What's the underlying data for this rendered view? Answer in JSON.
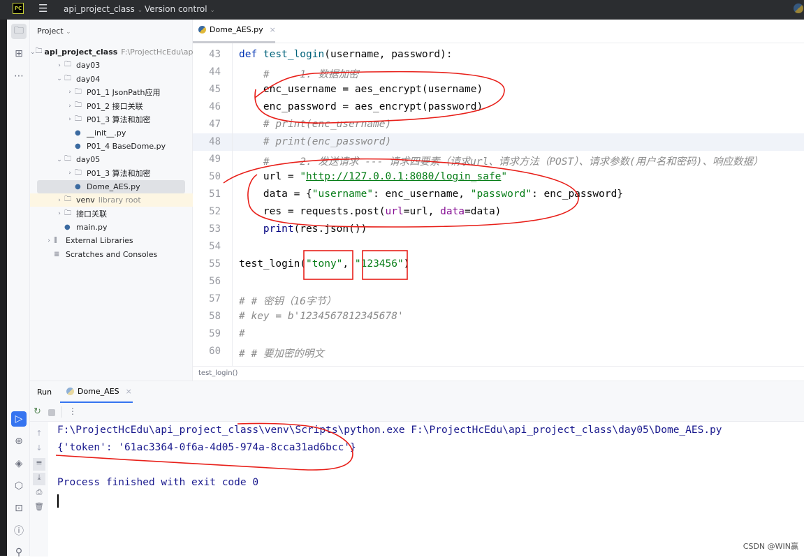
{
  "titlebar": {
    "project": "api_project_class",
    "vcs": "Version control"
  },
  "project": {
    "header": "Project",
    "tree": [
      {
        "label": "api_project_class",
        "hint": "F:\\ProjectHcEdu\\api",
        "depth": 0,
        "chev": "v",
        "icon": "folder",
        "bold": true
      },
      {
        "label": "day03",
        "depth": 1,
        "chev": ">",
        "icon": "package"
      },
      {
        "label": "day04",
        "depth": 1,
        "chev": "v",
        "icon": "package"
      },
      {
        "label": "P01_1 JsonPath应用",
        "depth": 2,
        "chev": ">",
        "icon": "package"
      },
      {
        "label": "P01_2 接口关联",
        "depth": 2,
        "chev": ">",
        "icon": "package"
      },
      {
        "label": "P01_3 算法和加密",
        "depth": 2,
        "chev": ">",
        "icon": "package"
      },
      {
        "label": "__init__.py",
        "depth": 2,
        "chev": "",
        "icon": "python"
      },
      {
        "label": "P01_4 BaseDome.py",
        "depth": 2,
        "chev": "",
        "icon": "python"
      },
      {
        "label": "day05",
        "depth": 1,
        "chev": "v",
        "icon": "folder"
      },
      {
        "label": "P01_3 算法和加密",
        "depth": 2,
        "chev": ">",
        "icon": "package"
      },
      {
        "label": "Dome_AES.py",
        "depth": 2,
        "chev": "",
        "icon": "python",
        "selected": true
      },
      {
        "label": "venv",
        "hint": "library root",
        "depth": 1,
        "chev": ">",
        "icon": "folder",
        "venv": true
      },
      {
        "label": "接口关联",
        "depth": 1,
        "chev": ">",
        "icon": "package"
      },
      {
        "label": "main.py",
        "depth": 1,
        "chev": "",
        "icon": "python"
      },
      {
        "label": "External Libraries",
        "depth": 0,
        "chev": ">",
        "icon": "library"
      },
      {
        "label": "Scratches and Consoles",
        "depth": 0,
        "chev": "",
        "icon": "scratch"
      }
    ]
  },
  "editor": {
    "tab": "Dome_AES.py",
    "breadcrumb": "test_login()",
    "current_line": 48,
    "lines": [
      {
        "n": 43,
        "seg": [
          [
            "def ",
            "kw"
          ],
          [
            "test_login",
            "fn"
          ],
          [
            "(username, password):",
            ""
          ]
        ]
      },
      {
        "n": 44,
        "seg": [
          [
            "    #     1. 数据加密",
            "cm"
          ]
        ]
      },
      {
        "n": 45,
        "seg": [
          [
            "    enc_username = aes_encrypt(username)",
            ""
          ]
        ]
      },
      {
        "n": 46,
        "seg": [
          [
            "    enc_password = aes_encrypt(password)",
            ""
          ]
        ]
      },
      {
        "n": 47,
        "seg": [
          [
            "    # print(enc_username)",
            "cm"
          ]
        ]
      },
      {
        "n": 48,
        "seg": [
          [
            "    # print(enc_password)",
            "cm"
          ]
        ]
      },
      {
        "n": 49,
        "seg": [
          [
            "    #     2. 发送请求 --- 请求四要素（请求url、请求方法（POST）、请求参数(用户名和密码)、响应数据）",
            "cm"
          ]
        ]
      },
      {
        "n": 50,
        "seg": [
          [
            "    url = ",
            ""
          ],
          [
            "\"",
            "st"
          ],
          [
            "http://127.0.0.1:8080/login_safe",
            "url"
          ],
          [
            "\"",
            "st"
          ]
        ]
      },
      {
        "n": 51,
        "seg": [
          [
            "    data = {",
            ""
          ],
          [
            "\"username\"",
            "st"
          ],
          [
            ": enc_username, ",
            ""
          ],
          [
            "\"password\"",
            "st"
          ],
          [
            ": enc_password}",
            ""
          ]
        ]
      },
      {
        "n": 52,
        "seg": [
          [
            "    res = requests.post(",
            ""
          ],
          [
            "url",
            "pm"
          ],
          [
            "=url, ",
            ""
          ],
          [
            "data",
            "pm"
          ],
          [
            "=data)",
            ""
          ]
        ]
      },
      {
        "n": 53,
        "seg": [
          [
            "    ",
            ""
          ],
          [
            "print",
            "bi"
          ],
          [
            "(res.json())",
            ""
          ]
        ]
      },
      {
        "n": 54,
        "seg": []
      },
      {
        "n": 55,
        "seg": [
          [
            "test_login(",
            ""
          ],
          [
            "\"tony\"",
            "st"
          ],
          [
            ", ",
            ""
          ],
          [
            "\"123456\"",
            "st"
          ],
          [
            ")",
            ""
          ]
        ]
      },
      {
        "n": 56,
        "seg": []
      },
      {
        "n": 57,
        "seg": [
          [
            "# # 密钥（16字节）",
            "cm"
          ]
        ]
      },
      {
        "n": 58,
        "seg": [
          [
            "# key = b'1234567812345678'",
            "cm"
          ]
        ]
      },
      {
        "n": 59,
        "seg": [
          [
            "#",
            "cm"
          ]
        ]
      },
      {
        "n": 60,
        "seg": [
          [
            "# # 要加密的明文",
            "cm"
          ]
        ]
      }
    ]
  },
  "run": {
    "label": "Run",
    "tab": "Dome_AES",
    "console": [
      "F:\\ProjectHcEdu\\api_project_class\\venv\\Scripts\\python.exe F:\\ProjectHcEdu\\api_project_class\\day05\\Dome_AES.py",
      "{'token': '61ac3364-0f6a-4d05-974a-8cca31ad6bcc'}",
      "",
      "Process finished with exit code 0"
    ]
  },
  "watermark": "CSDN @WIN赢",
  "colors": {
    "accent": "#3574f0",
    "annotation": "#e8201a",
    "titlebar": "#2b2d30"
  }
}
